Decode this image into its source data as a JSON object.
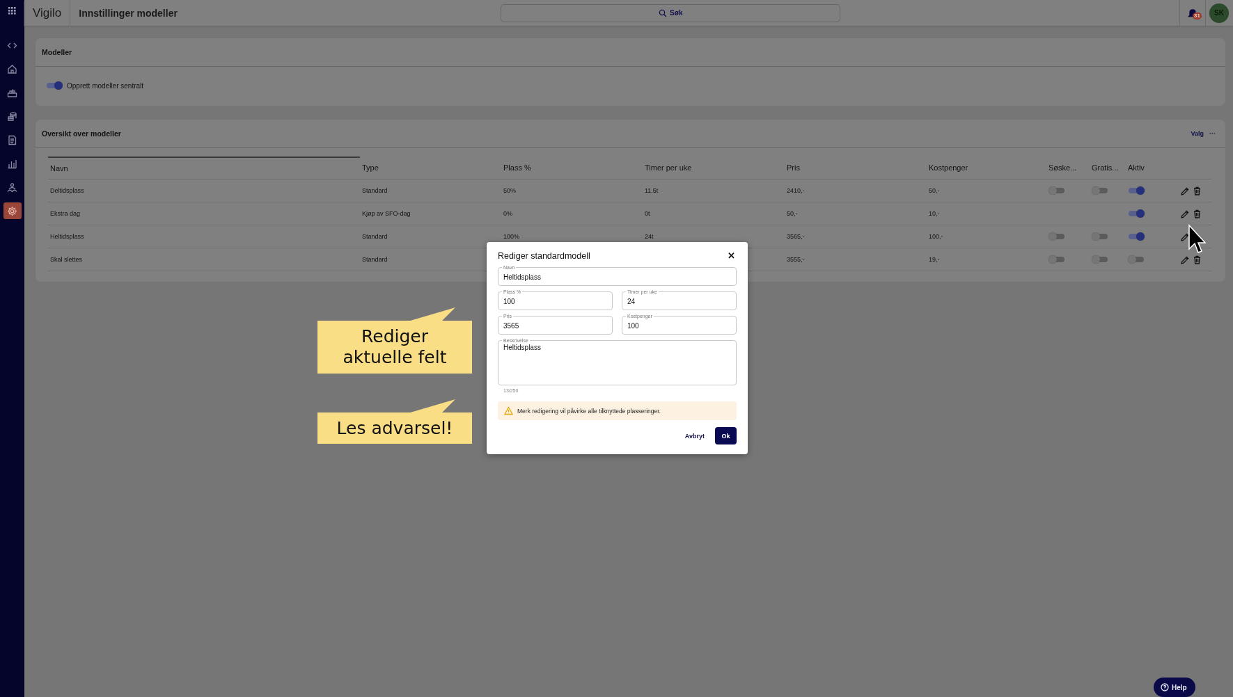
{
  "topbar": {
    "app_name": "Vigilo",
    "page_title": "Innstillinger modeller",
    "search": {
      "placeholder": "Søk"
    },
    "notification_count": "31",
    "avatar": "SK"
  },
  "sidebar": {
    "items": [
      {
        "kind": "code",
        "selected": false
      },
      {
        "kind": "home",
        "selected": false
      },
      {
        "kind": "basket",
        "selected": false
      },
      {
        "kind": "coins",
        "selected": false
      },
      {
        "kind": "document",
        "selected": false
      },
      {
        "kind": "chart",
        "selected": false
      },
      {
        "kind": "people",
        "selected": false
      },
      {
        "kind": "gear",
        "selected": true
      }
    ]
  },
  "models_section": {
    "title": "Modeller",
    "toggle": {
      "label": "Opprett modeller sentralt",
      "on": true
    }
  },
  "overview": {
    "title": "Oversikt over modeller",
    "options_label": "Valg",
    "options_icon": "···",
    "table": {
      "columns": [
        "Navn",
        "Type",
        "Plass %",
        "Timer per uke",
        "Pris",
        "Kostpenger",
        "Søske...",
        "Gratis...",
        "Aktiv"
      ],
      "rows": [
        {
          "cells": [
            "Deltidsplass",
            "Standard",
            "50%",
            "11.5t",
            "2410,-",
            "50,-"
          ],
          "sibling": false,
          "free": false,
          "active": true,
          "actions": [
            {
              "kind": "edit"
            },
            {
              "kind": "delete"
            }
          ]
        },
        {
          "cells": [
            "Ekstra dag",
            "Kjøp av SFO-dag",
            "0%",
            "0t",
            "50,-",
            "10,-"
          ],
          "active": true,
          "actions": [
            {
              "kind": "edit"
            },
            {
              "kind": "delete"
            }
          ]
        },
        {
          "cells": [
            "Heltidsplass",
            "Standard",
            "100%",
            "24t",
            "3565,-",
            "100,-"
          ],
          "sibling": false,
          "free": false,
          "active": true,
          "actions": [
            {
              "kind": "edit"
            }
          ]
        },
        {
          "cells": [
            "Skal slettes",
            "Standard",
            "",
            "",
            "3555,-",
            "19,-"
          ],
          "sibling": false,
          "free": false,
          "active": false,
          "actions": [
            {
              "kind": "edit"
            },
            {
              "kind": "delete"
            }
          ]
        }
      ]
    }
  },
  "dialog": {
    "title": "Rediger standardmodell",
    "close": "✕",
    "fields": [
      {
        "label": "Navn",
        "value": "Heltidsplass",
        "kind": "wide"
      },
      {
        "label": "Plass %",
        "value": "100",
        "kind": "half"
      },
      {
        "label": "Timer per uke",
        "value": "24",
        "kind": "half"
      },
      {
        "label": "Pris",
        "value": "3565",
        "kind": "half"
      },
      {
        "label": "Kostpenger",
        "value": "100",
        "kind": "half"
      },
      {
        "label": "Beskrivelse",
        "value": "Heltidsplass",
        "kind": "area"
      }
    ],
    "counter": "13/250",
    "warning": "Merk redigering vil påvirke alle tilknyttede plasseringer.",
    "buttons": [
      {
        "label": "Avbryt",
        "kind": "text"
      },
      {
        "label": "Ok",
        "kind": "primary"
      }
    ]
  },
  "callouts": [
    "Rediger aktuelle felt",
    "Les advarsel!"
  ],
  "help": {
    "label": "Help"
  }
}
